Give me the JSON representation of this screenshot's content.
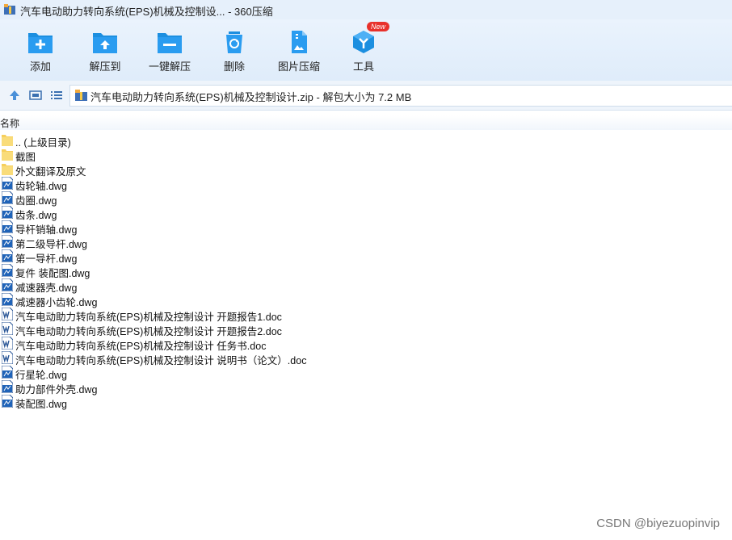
{
  "window": {
    "title": "汽车电动助力转向系统(EPS)机械及控制设... - 360压缩"
  },
  "toolbar": {
    "add_label": "添加",
    "extract_to_label": "解压到",
    "one_click_extract_label": "一键解压",
    "delete_label": "删除",
    "image_compress_label": "图片压缩",
    "tools_label": "工具",
    "new_badge": "New"
  },
  "address": {
    "text": "汽车电动助力转向系统(EPS)机械及控制设计.zip - 解包大小为 7.2 MB"
  },
  "columns": {
    "name": "名称"
  },
  "files": [
    {
      "name": ".. (上级目录)",
      "icon": "folder"
    },
    {
      "name": "截图",
      "icon": "folder"
    },
    {
      "name": "外文翻译及原文",
      "icon": "folder"
    },
    {
      "name": "齿轮轴.dwg",
      "icon": "dwg"
    },
    {
      "name": "齿圈.dwg",
      "icon": "dwg"
    },
    {
      "name": "齿条.dwg",
      "icon": "dwg"
    },
    {
      "name": "导杆销轴.dwg",
      "icon": "dwg"
    },
    {
      "name": "第二级导杆.dwg",
      "icon": "dwg"
    },
    {
      "name": "第一导杆.dwg",
      "icon": "dwg"
    },
    {
      "name": "复件 装配图.dwg",
      "icon": "dwg"
    },
    {
      "name": "减速器壳.dwg",
      "icon": "dwg"
    },
    {
      "name": "减速器小齿轮.dwg",
      "icon": "dwg"
    },
    {
      "name": "汽车电动助力转向系统(EPS)机械及控制设计 开题报告1.doc",
      "icon": "doc"
    },
    {
      "name": "汽车电动助力转向系统(EPS)机械及控制设计 开题报告2.doc",
      "icon": "doc"
    },
    {
      "name": "汽车电动助力转向系统(EPS)机械及控制设计 任务书.doc",
      "icon": "doc"
    },
    {
      "name": "汽车电动助力转向系统(EPS)机械及控制设计 说明书（论文）.doc",
      "icon": "doc"
    },
    {
      "name": "行星轮.dwg",
      "icon": "dwg"
    },
    {
      "name": "助力部件外壳.dwg",
      "icon": "dwg"
    },
    {
      "name": "装配图.dwg",
      "icon": "dwg"
    }
  ],
  "watermark": "CSDN @biyezuopinvip",
  "colors": {
    "accent": "#1c8fe0",
    "folder": "#f6cf5c",
    "word": "#2b5797",
    "badge": "#e8312b"
  }
}
